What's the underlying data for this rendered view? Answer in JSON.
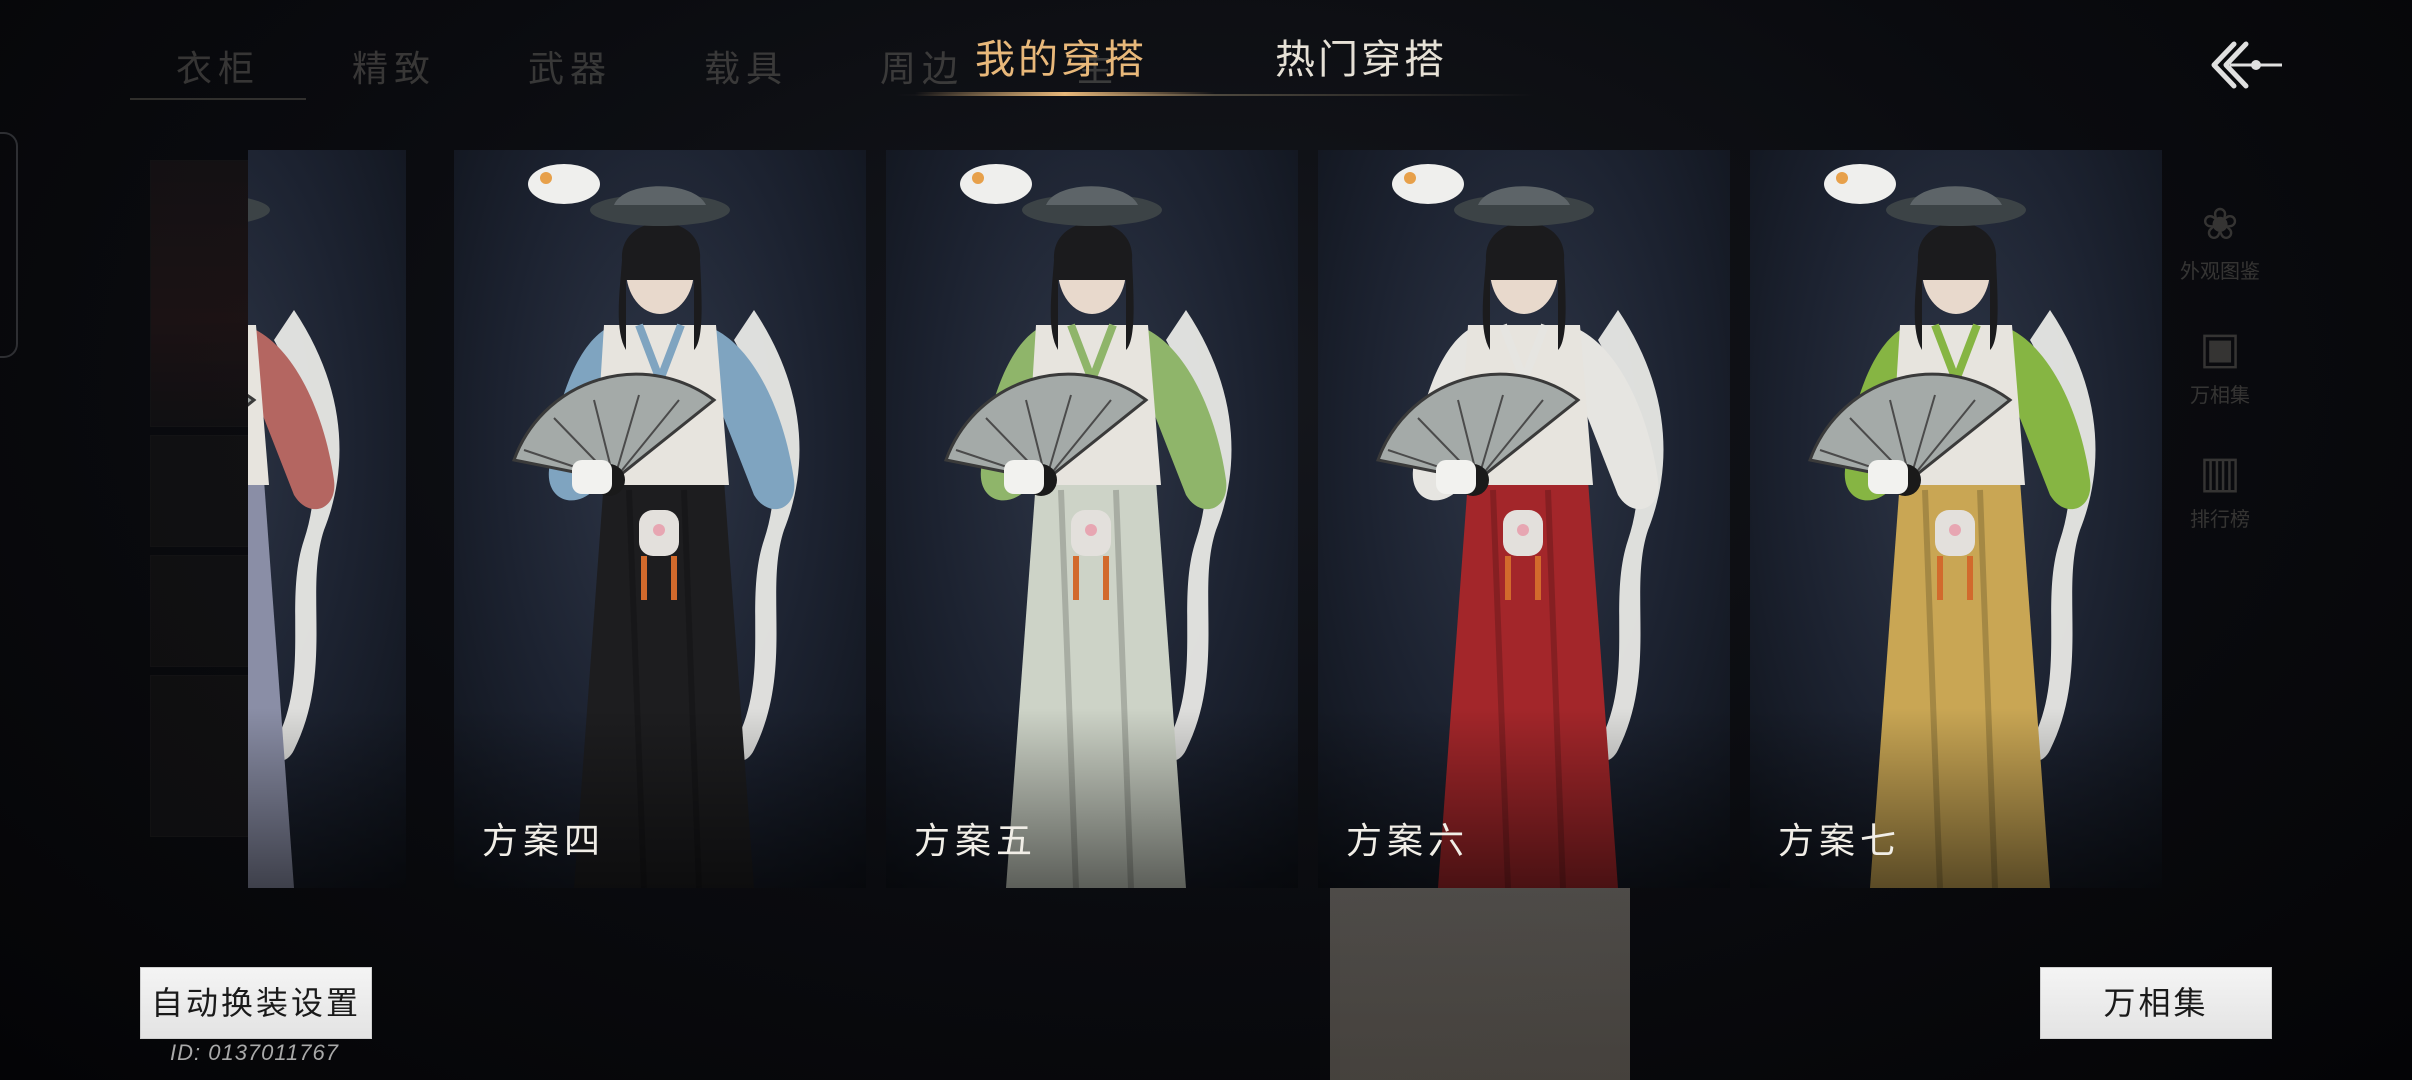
{
  "background_menu": {
    "tabs": [
      "衣柜",
      "精致",
      "武器",
      "载具",
      "周边",
      "主"
    ],
    "right_items": [
      "外观图鉴",
      "万相集",
      "排行榜"
    ]
  },
  "top_tabs": [
    {
      "label": "我的穿搭",
      "active": true
    },
    {
      "label": "热门穿搭",
      "active": false
    }
  ],
  "outfits": [
    {
      "name": "",
      "skirt_color": "#8a8ea6",
      "sleeve_color": "#b46661"
    },
    {
      "name": "方案四",
      "skirt_color": "#1d1d1f",
      "sleeve_color": "#7fa4c0"
    },
    {
      "name": "方案五",
      "skirt_color": "#cdd3c7",
      "sleeve_color": "#8fb56a"
    },
    {
      "name": "方案六",
      "skirt_color": "#a3262a",
      "sleeve_color": "#e6e5e1"
    },
    {
      "name": "方案七",
      "skirt_color": "#c9a654",
      "sleeve_color": "#86b543"
    }
  ],
  "buttons": {
    "auto_change_settings": "自动换装设置",
    "wanxiangji": "万相集"
  },
  "player_id": "ID: 0137011767",
  "colors": {
    "accent": "#e8b87a",
    "text_light": "#e6e1d6"
  }
}
